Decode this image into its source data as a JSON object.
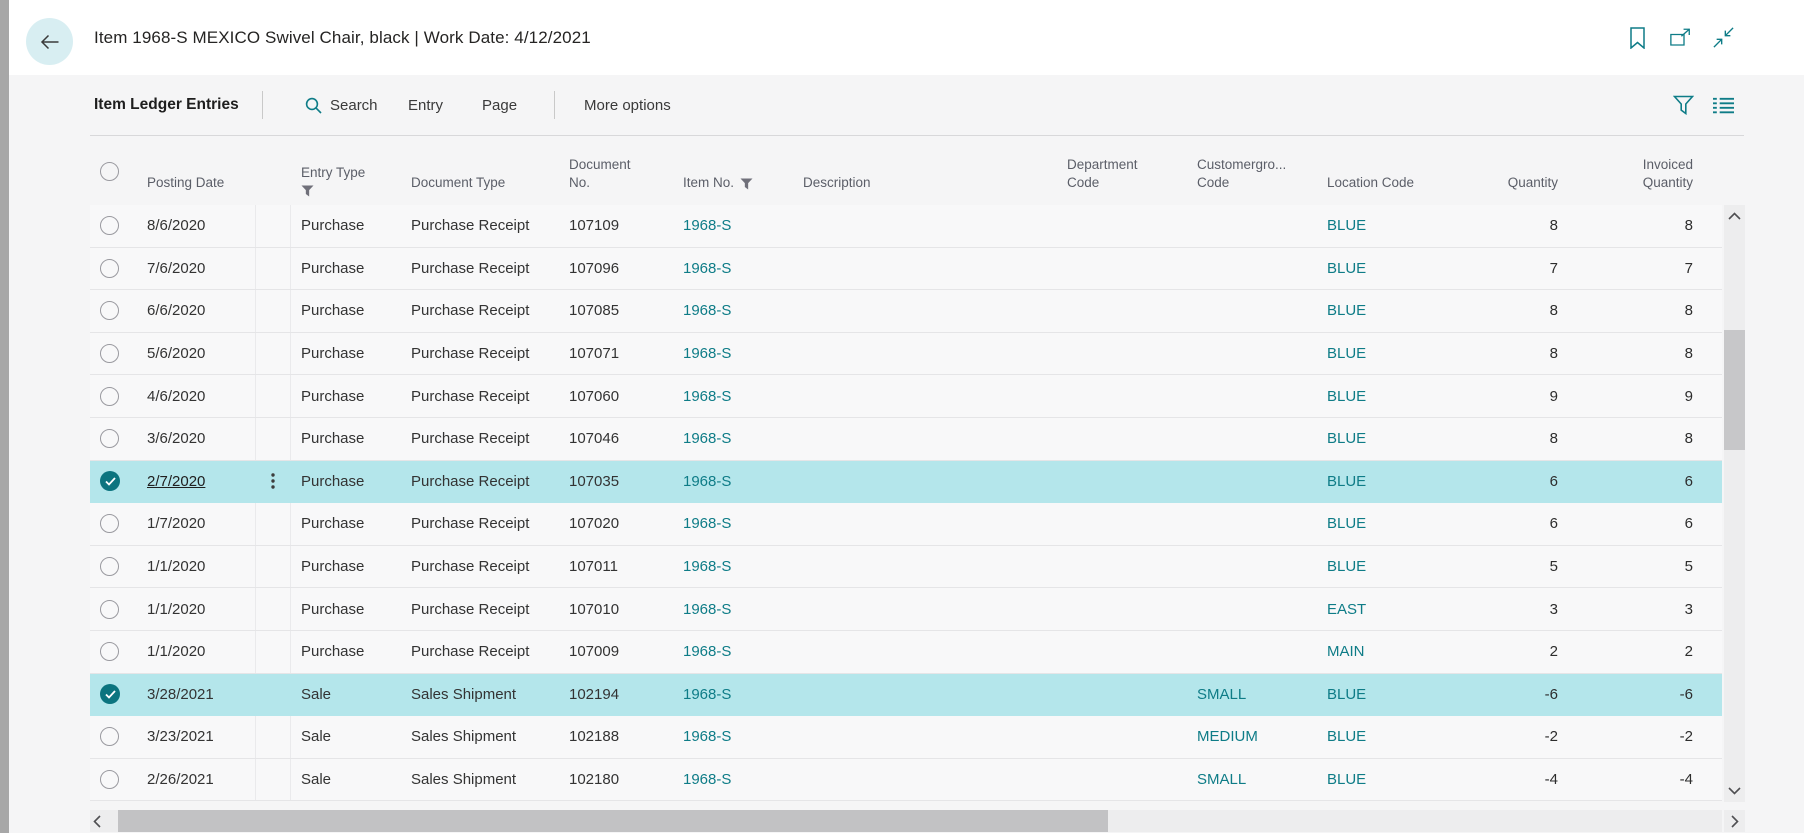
{
  "app_bar": {
    "title": "Item 1968-S MEXICO Swivel Chair, black | Work Date: 4/12/2021",
    "icons": [
      "back-arrow-icon",
      "bookmark-icon",
      "open-in-new-window-icon",
      "collapse-icon"
    ]
  },
  "toolbar": {
    "caption": "Item Ledger Entries",
    "search_label": "Search",
    "entry_label": "Entry",
    "page_label": "Page",
    "more_options_label": "More options",
    "right_icons": [
      "filter-icon",
      "list-view-icon"
    ]
  },
  "table": {
    "headers": {
      "posting_date": "Posting Date",
      "entry_type": "Entry Type",
      "document_type": "Document Type",
      "document_no_line1": "Document",
      "document_no_line2": "No.",
      "item_no": "Item No.",
      "description": "Description",
      "department_line1": "Department",
      "department_line2": "Code",
      "customergroup_line1": "Customergro...",
      "customergroup_line2": "Code",
      "location_code": "Location Code",
      "quantity": "Quantity",
      "invoiced_line1": "Invoiced",
      "invoiced_line2": "Quantity"
    },
    "filtered_columns": [
      "Entry Type",
      "Item No."
    ],
    "rows": [
      {
        "posting_date": "8/6/2020",
        "entry_type": "Purchase",
        "document_type": "Purchase Receipt",
        "document_no": "107109",
        "item_no": "1968-S",
        "description": "",
        "department_code": "",
        "customergroup_code": "",
        "location_code": "BLUE",
        "quantity": "8",
        "invoiced_quantity": "8",
        "selected": false,
        "focused": false
      },
      {
        "posting_date": "7/6/2020",
        "entry_type": "Purchase",
        "document_type": "Purchase Receipt",
        "document_no": "107096",
        "item_no": "1968-S",
        "description": "",
        "department_code": "",
        "customergroup_code": "",
        "location_code": "BLUE",
        "quantity": "7",
        "invoiced_quantity": "7",
        "selected": false,
        "focused": false
      },
      {
        "posting_date": "6/6/2020",
        "entry_type": "Purchase",
        "document_type": "Purchase Receipt",
        "document_no": "107085",
        "item_no": "1968-S",
        "description": "",
        "department_code": "",
        "customergroup_code": "",
        "location_code": "BLUE",
        "quantity": "8",
        "invoiced_quantity": "8",
        "selected": false,
        "focused": false
      },
      {
        "posting_date": "5/6/2020",
        "entry_type": "Purchase",
        "document_type": "Purchase Receipt",
        "document_no": "107071",
        "item_no": "1968-S",
        "description": "",
        "department_code": "",
        "customergroup_code": "",
        "location_code": "BLUE",
        "quantity": "8",
        "invoiced_quantity": "8",
        "selected": false,
        "focused": false
      },
      {
        "posting_date": "4/6/2020",
        "entry_type": "Purchase",
        "document_type": "Purchase Receipt",
        "document_no": "107060",
        "item_no": "1968-S",
        "description": "",
        "department_code": "",
        "customergroup_code": "",
        "location_code": "BLUE",
        "quantity": "9",
        "invoiced_quantity": "9",
        "selected": false,
        "focused": false
      },
      {
        "posting_date": "3/6/2020",
        "entry_type": "Purchase",
        "document_type": "Purchase Receipt",
        "document_no": "107046",
        "item_no": "1968-S",
        "description": "",
        "department_code": "",
        "customergroup_code": "",
        "location_code": "BLUE",
        "quantity": "8",
        "invoiced_quantity": "8",
        "selected": false,
        "focused": false
      },
      {
        "posting_date": "2/7/2020",
        "entry_type": "Purchase",
        "document_type": "Purchase Receipt",
        "document_no": "107035",
        "item_no": "1968-S",
        "description": "",
        "department_code": "",
        "customergroup_code": "",
        "location_code": "BLUE",
        "quantity": "6",
        "invoiced_quantity": "6",
        "selected": true,
        "focused": true
      },
      {
        "posting_date": "1/7/2020",
        "entry_type": "Purchase",
        "document_type": "Purchase Receipt",
        "document_no": "107020",
        "item_no": "1968-S",
        "description": "",
        "department_code": "",
        "customergroup_code": "",
        "location_code": "BLUE",
        "quantity": "6",
        "invoiced_quantity": "6",
        "selected": false,
        "focused": false
      },
      {
        "posting_date": "1/1/2020",
        "entry_type": "Purchase",
        "document_type": "Purchase Receipt",
        "document_no": "107011",
        "item_no": "1968-S",
        "description": "",
        "department_code": "",
        "customergroup_code": "",
        "location_code": "BLUE",
        "quantity": "5",
        "invoiced_quantity": "5",
        "selected": false,
        "focused": false
      },
      {
        "posting_date": "1/1/2020",
        "entry_type": "Purchase",
        "document_type": "Purchase Receipt",
        "document_no": "107010",
        "item_no": "1968-S",
        "description": "",
        "department_code": "",
        "customergroup_code": "",
        "location_code": "EAST",
        "quantity": "3",
        "invoiced_quantity": "3",
        "selected": false,
        "focused": false
      },
      {
        "posting_date": "1/1/2020",
        "entry_type": "Purchase",
        "document_type": "Purchase Receipt",
        "document_no": "107009",
        "item_no": "1968-S",
        "description": "",
        "department_code": "",
        "customergroup_code": "",
        "location_code": "MAIN",
        "quantity": "2",
        "invoiced_quantity": "2",
        "selected": false,
        "focused": false
      },
      {
        "posting_date": "3/28/2021",
        "entry_type": "Sale",
        "document_type": "Sales Shipment",
        "document_no": "102194",
        "item_no": "1968-S",
        "description": "",
        "department_code": "",
        "customergroup_code": "SMALL",
        "location_code": "BLUE",
        "quantity": "-6",
        "invoiced_quantity": "-6",
        "selected": true,
        "focused": false
      },
      {
        "posting_date": "3/23/2021",
        "entry_type": "Sale",
        "document_type": "Sales Shipment",
        "document_no": "102188",
        "item_no": "1968-S",
        "description": "",
        "department_code": "",
        "customergroup_code": "MEDIUM",
        "location_code": "BLUE",
        "quantity": "-2",
        "invoiced_quantity": "-2",
        "selected": false,
        "focused": false
      },
      {
        "posting_date": "2/26/2021",
        "entry_type": "Sale",
        "document_type": "Sales Shipment",
        "document_no": "102180",
        "item_no": "1968-S",
        "description": "",
        "department_code": "",
        "customergroup_code": "SMALL",
        "location_code": "BLUE",
        "quantity": "-4",
        "invoiced_quantity": "-4",
        "selected": false,
        "focused": false
      }
    ]
  },
  "colors": {
    "accent_teal": "#0e7c87",
    "link_teal": "#0e7c87",
    "selected_row_bg": "#b4e6eb",
    "selected_check_bg": "#0c747f",
    "pane_bg": "#f5f5f6",
    "row_bg": "#f8f8f9",
    "back_circle_bg": "#d8eef2"
  }
}
